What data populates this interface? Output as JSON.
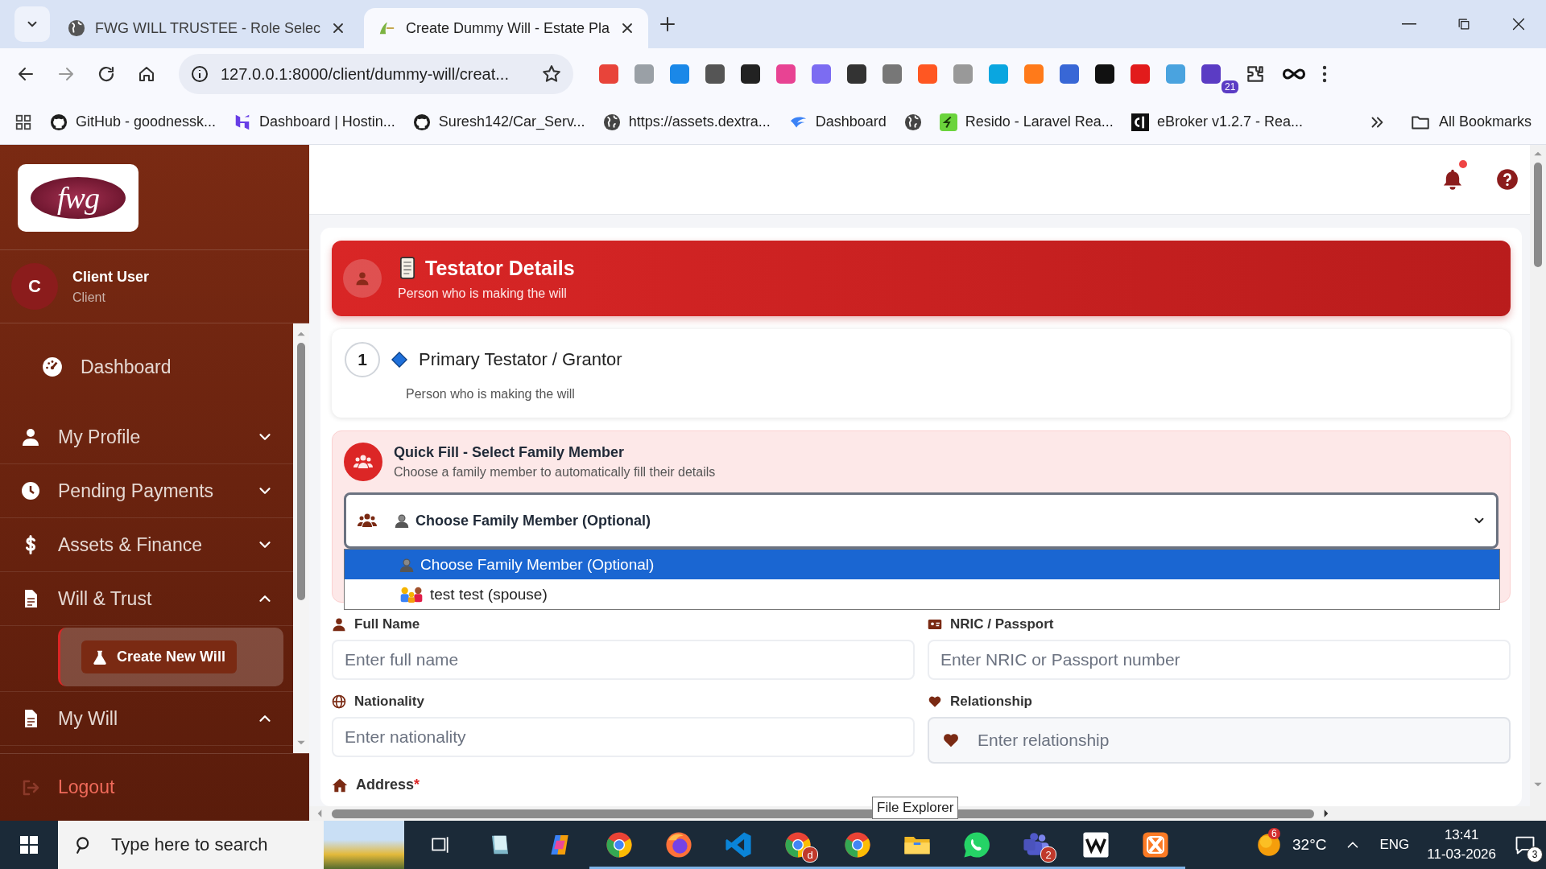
{
  "browser": {
    "tabs": [
      {
        "title": "FWG WILL TRUSTEE - Role Selec",
        "selected": false
      },
      {
        "title": "Create Dummy Will - Estate Pla",
        "selected": true
      }
    ],
    "address": "127.0.0.1:8000/client/dummy-will/creat...",
    "extension_badge": "21",
    "bookmarks": [
      {
        "kind": "github",
        "label": "GitHub - goodnessk..."
      },
      {
        "kind": "hostinger",
        "label": "Dashboard | Hostin..."
      },
      {
        "kind": "github",
        "label": "Suresh142/Car_Serv..."
      },
      {
        "kind": "globe",
        "label": "https://assets.dextra..."
      },
      {
        "kind": "wing",
        "label": "Dashboard"
      },
      {
        "kind": "globe"
      },
      {
        "kind": "leaf",
        "label": "Resido - Laravel Rea..."
      },
      {
        "kind": "cl",
        "label": "eBroker v1.2.7 - Rea..."
      }
    ],
    "all_bookmarks": "All Bookmarks"
  },
  "sidebar": {
    "logo_text": "fwg",
    "user": {
      "initial": "C",
      "name": "Client User",
      "role": "Client"
    },
    "nav": [
      {
        "kind": "link",
        "label": "Dashboard"
      },
      {
        "kind": "group",
        "label": "My Profile",
        "expanded": false
      },
      {
        "kind": "group",
        "label": "Pending Payments",
        "expanded": false
      },
      {
        "kind": "group",
        "label": "Assets & Finance",
        "expanded": false
      },
      {
        "kind": "group",
        "label": "Will & Trust",
        "expanded": true,
        "children": [
          {
            "label": "Create New Will",
            "selected": true
          }
        ]
      },
      {
        "kind": "group",
        "label": "My Will",
        "expanded": true
      }
    ],
    "logout": "Logout"
  },
  "header": {
    "notification": true
  },
  "testator": {
    "title": "Testator Details",
    "subtitle": "Person who is making the will"
  },
  "primary": {
    "number": "1",
    "title": "Primary Testator / Grantor",
    "subtitle": "Person who is making the will"
  },
  "quick_fill": {
    "title": "Quick Fill - Select Family Member",
    "subtitle": "Choose a family member to automatically fill their details",
    "select": {
      "value": "Choose Family Member (Optional)",
      "expanded": true,
      "options": [
        {
          "kind": "person",
          "label": "Choose Family Member (Optional)",
          "selected": true
        },
        {
          "kind": "family",
          "label": "test test (spouse)",
          "selected": false
        }
      ]
    }
  },
  "fields": [
    {
      "label": "Full Name",
      "placeholder": "Enter full name",
      "icon_inside": false
    },
    {
      "label": "NRIC / Passport",
      "placeholder": "Enter NRIC or Passport number",
      "icon_inside": false
    },
    {
      "label": "Nationality",
      "placeholder": "Enter nationality",
      "icon_inside": false
    },
    {
      "label": "Relationship",
      "placeholder": "Enter relationship",
      "icon_inside": true
    }
  ],
  "address": {
    "label": "Address",
    "required_mark": "*"
  },
  "tooltip": "File Explorer",
  "taskbar": {
    "search_placeholder": "Type here to search",
    "apps": [
      {
        "kind": "task-view",
        "running": false
      },
      {
        "kind": "notepad",
        "running": false
      },
      {
        "kind": "copilot",
        "running": false
      },
      {
        "kind": "chrome",
        "running": true
      },
      {
        "kind": "firefox",
        "running": true
      },
      {
        "kind": "vscode",
        "running": true
      },
      {
        "kind": "chrome",
        "running": true,
        "badge": "d"
      },
      {
        "kind": "chrome",
        "running": true
      },
      {
        "kind": "folder",
        "running": true
      },
      {
        "kind": "whatsapp",
        "running": true
      },
      {
        "kind": "teams",
        "running": true,
        "badge": "2"
      },
      {
        "kind": "wave",
        "running": true
      },
      {
        "kind": "xampp",
        "running": true
      }
    ],
    "weather_badge": "6",
    "temperature": "32°C",
    "language": "ENG",
    "time": "13:41",
    "date": "11-03-2026",
    "notifications": "3"
  }
}
